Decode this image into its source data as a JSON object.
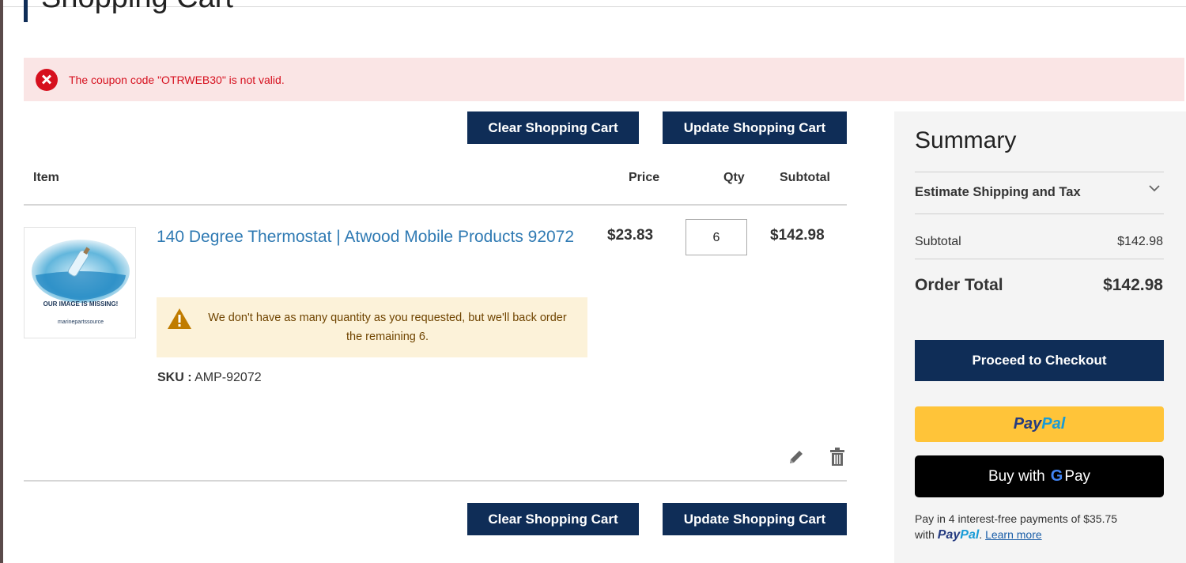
{
  "page": {
    "title": "Shopping Cart"
  },
  "error": {
    "message": "The coupon code \"OTRWEB30\" is not valid.",
    "icon": "error-circle-icon",
    "color": "#d6101e"
  },
  "actions": {
    "clear_label": "Clear Shopping Cart",
    "update_label": "Update Shopping Cart"
  },
  "table": {
    "headers": {
      "item": "Item",
      "price": "Price",
      "qty": "Qty",
      "subtotal": "Subtotal"
    }
  },
  "cart_item": {
    "name": "140 Degree Thermostat | Atwood Mobile Products 92072",
    "price": "$23.83",
    "qty": "6",
    "subtotal": "$142.98",
    "sku_label": "SKU :",
    "sku_value": "AMP-92072",
    "image": {
      "caption": "OUR IMAGE IS MISSING!",
      "brand": "marinepartssource"
    },
    "warning": "We don't have as many quantity as you requested, but we'll back order the remaining 6."
  },
  "summary": {
    "title": "Summary",
    "shipping_label": "Estimate Shipping and Tax",
    "subtotal_label": "Subtotal",
    "subtotal_value": "$142.98",
    "order_total_label": "Order Total",
    "order_total_value": "$142.98",
    "checkout_label": "Proceed to Checkout",
    "paypal": {
      "pay": "Pay",
      "pal": "Pal"
    },
    "gpay": {
      "prefix": "Buy with",
      "suffix": "Pay"
    },
    "paylater": {
      "text": "Pay in 4 interest-free payments of $35.75",
      "with": "with",
      "learn_more": "Learn more"
    }
  },
  "colors": {
    "primary": "#0f2d57",
    "link": "#2f7ab3",
    "error_bg": "#fae5e5",
    "warning_bg": "#fcf2d9",
    "paypal_yellow": "#ffc439"
  }
}
